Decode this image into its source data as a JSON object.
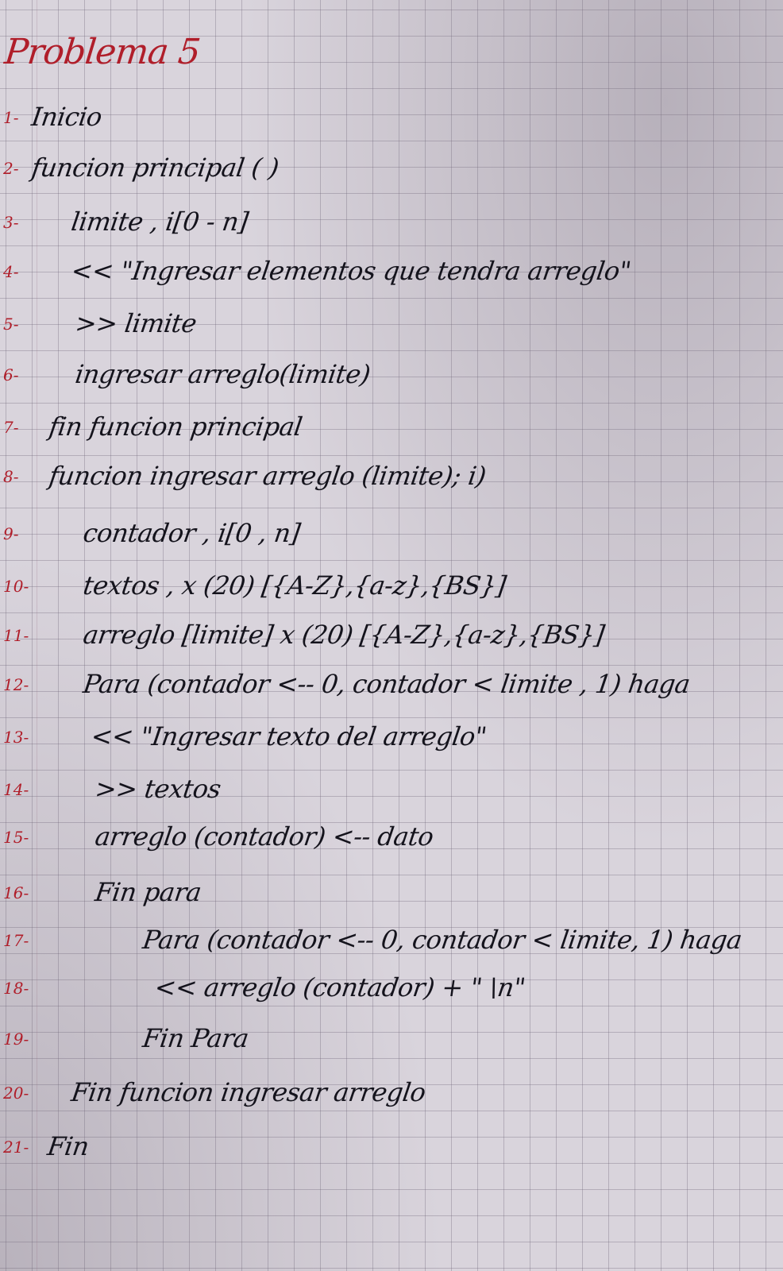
{
  "title": "Problema 5",
  "lines": [
    {
      "num": "1-",
      "text": "Inicio"
    },
    {
      "num": "2-",
      "text": "funcion principal ( )"
    },
    {
      "num": "3-",
      "text": "limite , i[0 - n]"
    },
    {
      "num": "4-",
      "text": "<< \"Ingresar elementos que tendra arreglo\""
    },
    {
      "num": "5-",
      "text": ">> limite"
    },
    {
      "num": "6-",
      "text": "ingresar arreglo(limite)"
    },
    {
      "num": "7-",
      "text": "fin funcion principal"
    },
    {
      "num": "8-",
      "text": "funcion ingresar arreglo (limite); i)"
    },
    {
      "num": "9-",
      "text": "contador , i[0 , n]"
    },
    {
      "num": "10-",
      "text": "textos , x (20) [{A-Z},{a-z},{BS}]"
    },
    {
      "num": "11-",
      "text": "arreglo [limite] x (20) [{A-Z},{a-z},{BS}]"
    },
    {
      "num": "12-",
      "text": "Para (contador <-- 0, contador < limite , 1) haga"
    },
    {
      "num": "13-",
      "text": "<< \"Ingresar texto del arreglo\""
    },
    {
      "num": "14-",
      "text": ">> textos"
    },
    {
      "num": "15-",
      "text": "arreglo (contador) <-- dato"
    },
    {
      "num": "16-",
      "text": "Fin para"
    },
    {
      "num": "17-",
      "text": "Para (contador <-- 0, contador < limite, 1) haga"
    },
    {
      "num": "18-",
      "text": "<< arreglo (contador) + \" \\n\""
    },
    {
      "num": "19-",
      "text": "Fin Para"
    },
    {
      "num": "20-",
      "text": "Fin funcion ingresar arreglo"
    },
    {
      "num": "21-",
      "text": "Fin"
    }
  ]
}
